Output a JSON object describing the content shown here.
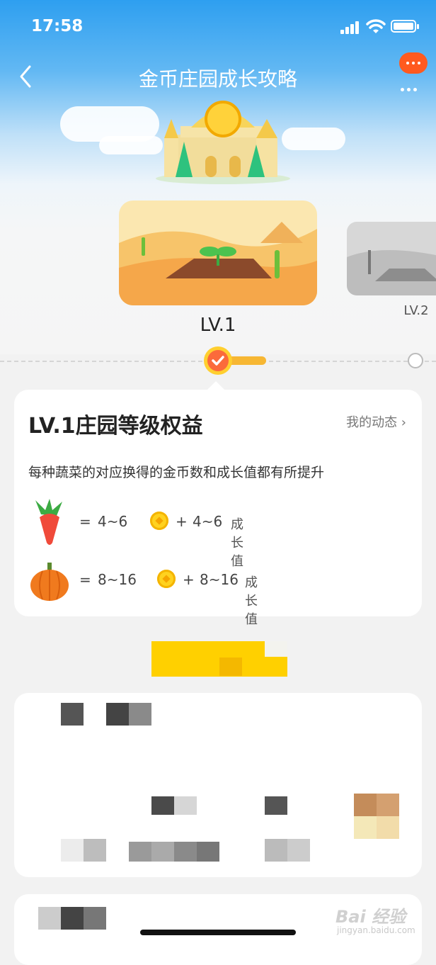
{
  "status_bar": {
    "time": "17:58"
  },
  "nav": {
    "title": "金币庄园成长攻略"
  },
  "levels": [
    {
      "label": "LV.1",
      "current": true
    },
    {
      "label": "LV.2",
      "current": false
    }
  ],
  "benefits": {
    "title": "LV.1庄园等级权益",
    "link": "我的动态 ›",
    "description": "每种蔬菜的对应换得的金币数和成长值都有所提升",
    "rows": [
      {
        "icon": "carrot-icon",
        "equals": "=",
        "coins": "4~6",
        "plus": "+",
        "growth": "4~6",
        "unit": "成长值"
      },
      {
        "icon": "pumpkin-icon",
        "equals": "=",
        "coins": "8~16",
        "plus": "+",
        "growth": "8~16",
        "unit": "成长值"
      }
    ]
  },
  "watermark": {
    "main": "Bai 经验",
    "sub": "jingyan.baidu.com"
  },
  "colors": {
    "accent_orange": "#fb6a3b",
    "coin_yellow": "#ffd21f",
    "sky_blue": "#2e9ff0"
  }
}
